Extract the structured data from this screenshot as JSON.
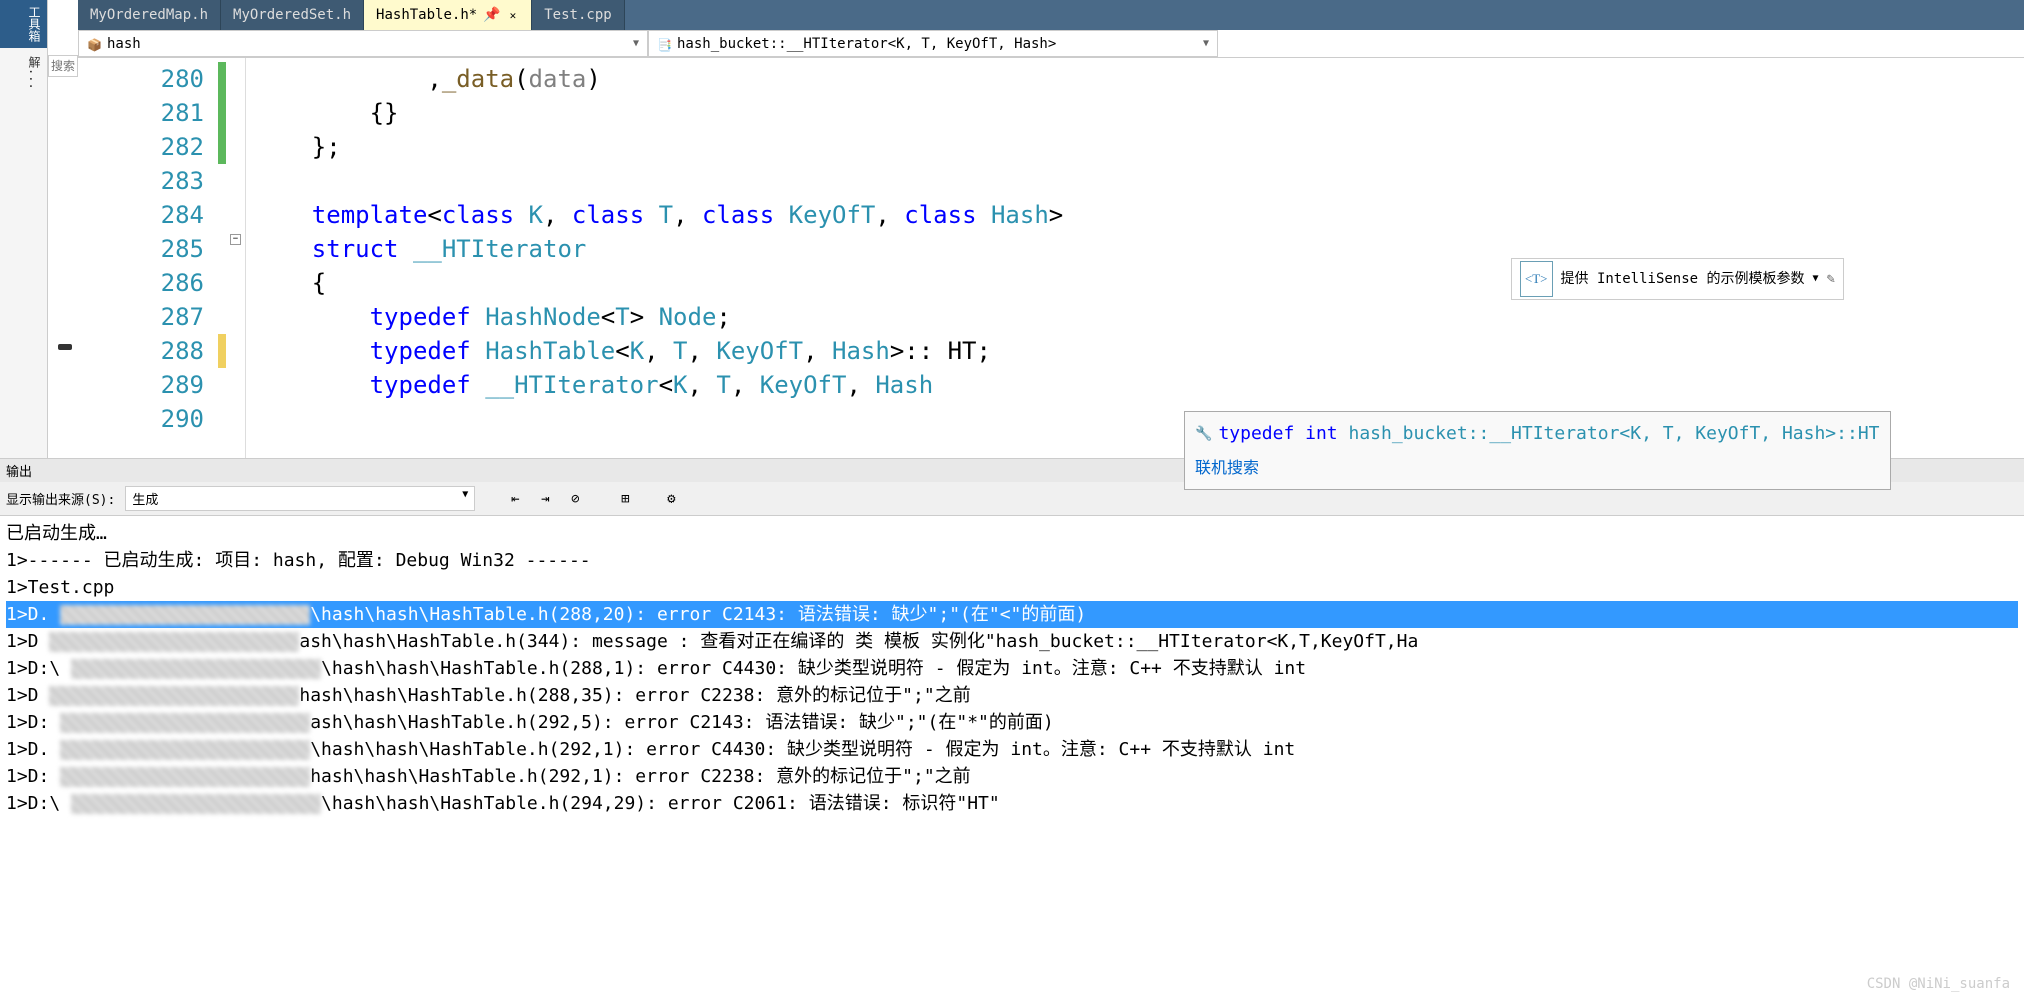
{
  "left_sidebar": {
    "tab1": "工具箱",
    "tab2": "解...",
    "search_placeholder": "搜索"
  },
  "tabs": [
    {
      "label": "MyOrderedMap.h",
      "active": false
    },
    {
      "label": "MyOrderedSet.h",
      "active": false
    },
    {
      "label": "HashTable.h*",
      "active": true,
      "closable": true
    },
    {
      "label": "Test.cpp",
      "active": false
    }
  ],
  "navbar": {
    "scope": "hash",
    "member": "hash_bucket::__HTIterator<K, T, KeyOfT, Hash>"
  },
  "intellisense_hint": {
    "badge": "<T>",
    "text": "提供 IntelliSense 的示例模板参数"
  },
  "code": {
    "lines": [
      {
        "num": "280",
        "change": "green",
        "html": "            ,_data(data)",
        "tokens": [
          [
            "            ,",
            "punc"
          ],
          [
            "_data",
            "fn"
          ],
          [
            "(",
            "punc"
          ],
          [
            "data",
            "param"
          ],
          [
            ")",
            "punc"
          ]
        ]
      },
      {
        "num": "281",
        "change": "green",
        "html": "        {}",
        "tokens": [
          [
            "        {}",
            "punc"
          ]
        ]
      },
      {
        "num": "282",
        "change": "green",
        "html": "    };",
        "tokens": [
          [
            "    };",
            "punc"
          ]
        ]
      },
      {
        "num": "283",
        "change": "",
        "html": "",
        "tokens": []
      },
      {
        "num": "284",
        "change": "",
        "html": "    template<class K, class T, class KeyOfT, class Hash>",
        "tokens": [
          [
            "    ",
            "punc"
          ],
          [
            "template",
            "kw"
          ],
          [
            "<",
            "punc"
          ],
          [
            "class ",
            "kw"
          ],
          [
            "K",
            "type"
          ],
          [
            ", ",
            "punc"
          ],
          [
            "class ",
            "kw"
          ],
          [
            "T",
            "type"
          ],
          [
            ", ",
            "punc"
          ],
          [
            "class ",
            "kw"
          ],
          [
            "KeyOfT",
            "type"
          ],
          [
            ", ",
            "punc"
          ],
          [
            "class ",
            "kw"
          ],
          [
            "Hash",
            "type"
          ],
          [
            ">",
            "punc"
          ]
        ]
      },
      {
        "num": "285",
        "change": "",
        "html": "    struct __HTIterator",
        "tokens": [
          [
            "    ",
            "punc"
          ],
          [
            "struct ",
            "kw"
          ],
          [
            "__HTIterator",
            "type"
          ]
        ]
      },
      {
        "num": "286",
        "change": "",
        "html": "    {",
        "tokens": [
          [
            "    {",
            "punc"
          ]
        ]
      },
      {
        "num": "287",
        "change": "",
        "html": "        typedef HashNode<T> Node;",
        "tokens": [
          [
            "        ",
            "punc"
          ],
          [
            "typedef ",
            "kw"
          ],
          [
            "HashNode",
            "type"
          ],
          [
            "<",
            "punc"
          ],
          [
            "T",
            "type"
          ],
          [
            "> ",
            "punc"
          ],
          [
            "Node",
            "type"
          ],
          [
            ";",
            "punc"
          ]
        ]
      },
      {
        "num": "288",
        "change": "yellow",
        "html": "        typedef HashTable<K, T, KeyOfT, Hash>:: HT;",
        "tokens": [
          [
            "        ",
            "punc"
          ],
          [
            "typedef ",
            "kw"
          ],
          [
            "HashTable",
            "type"
          ],
          [
            "<",
            "punc"
          ],
          [
            "K",
            "type"
          ],
          [
            ", ",
            "punc"
          ],
          [
            "T",
            "type"
          ],
          [
            ", ",
            "punc"
          ],
          [
            "KeyOfT",
            "type"
          ],
          [
            ", ",
            "punc"
          ],
          [
            "Hash",
            "type"
          ],
          [
            ">:: ",
            "punc"
          ],
          [
            "HT",
            "ident"
          ],
          [
            ";",
            "punc"
          ]
        ]
      },
      {
        "num": "289",
        "change": "",
        "html": "        typedef __HTIterator<K, T, KeyOfT, Hash",
        "tokens": [
          [
            "        ",
            "punc"
          ],
          [
            "typedef ",
            "kw"
          ],
          [
            "__HTIterator",
            "type"
          ],
          [
            "<",
            "punc"
          ],
          [
            "K",
            "type"
          ],
          [
            ", ",
            "punc"
          ],
          [
            "T",
            "type"
          ],
          [
            ", ",
            "punc"
          ],
          [
            "KeyOfT",
            "type"
          ],
          [
            ", ",
            "punc"
          ],
          [
            "Hash",
            "type"
          ]
        ]
      },
      {
        "num": "290",
        "change": "",
        "html": "",
        "tokens": []
      }
    ]
  },
  "tooltip": {
    "line1_prefix": "typedef int ",
    "line1_type": "hash_bucket::__HTIterator<K, T, KeyOfT, Hash>::HT",
    "line2": "联机搜索"
  },
  "output": {
    "header": "输出",
    "source_label": "显示输出来源(S):",
    "source_value": "生成",
    "lines": [
      "已启动生成…",
      "1>------ 已启动生成: 项目: hash, 配置: Debug Win32 ------",
      "1>Test.cpp",
      "1>D.                       \\hash\\hash\\HashTable.h(288,20): error C2143: 语法错误: 缺少\";\"(在\"<\"的前面)",
      "1>D                        ash\\hash\\HashTable.h(344): message : 查看对正在编译的 类 模板 实例化\"hash_bucket::__HTIterator<K,T,KeyOfT,Ha",
      "1>D:\\                      \\hash\\hash\\HashTable.h(288,1): error C4430: 缺少类型说明符 - 假定为 int。注意: C++ 不支持默认 int",
      "1>D                        hash\\hash\\HashTable.h(288,35): error C2238: 意外的标记位于\";\"之前",
      "1>D:                       ash\\hash\\HashTable.h(292,5): error C2143: 语法错误: 缺少\";\"(在\"*\"的前面)",
      "1>D.                       \\hash\\hash\\HashTable.h(292,1): error C4430: 缺少类型说明符 - 假定为 int。注意: C++ 不支持默认 int",
      "1>D:                       hash\\hash\\HashTable.h(292,1): error C2238: 意外的标记位于\";\"之前",
      "1>D:\\                      \\hash\\hash\\HashTable.h(294,29): error C2061: 语法错误: 标识符\"HT\""
    ],
    "selected_index": 3
  },
  "watermark": "CSDN @NiNi_suanfa"
}
